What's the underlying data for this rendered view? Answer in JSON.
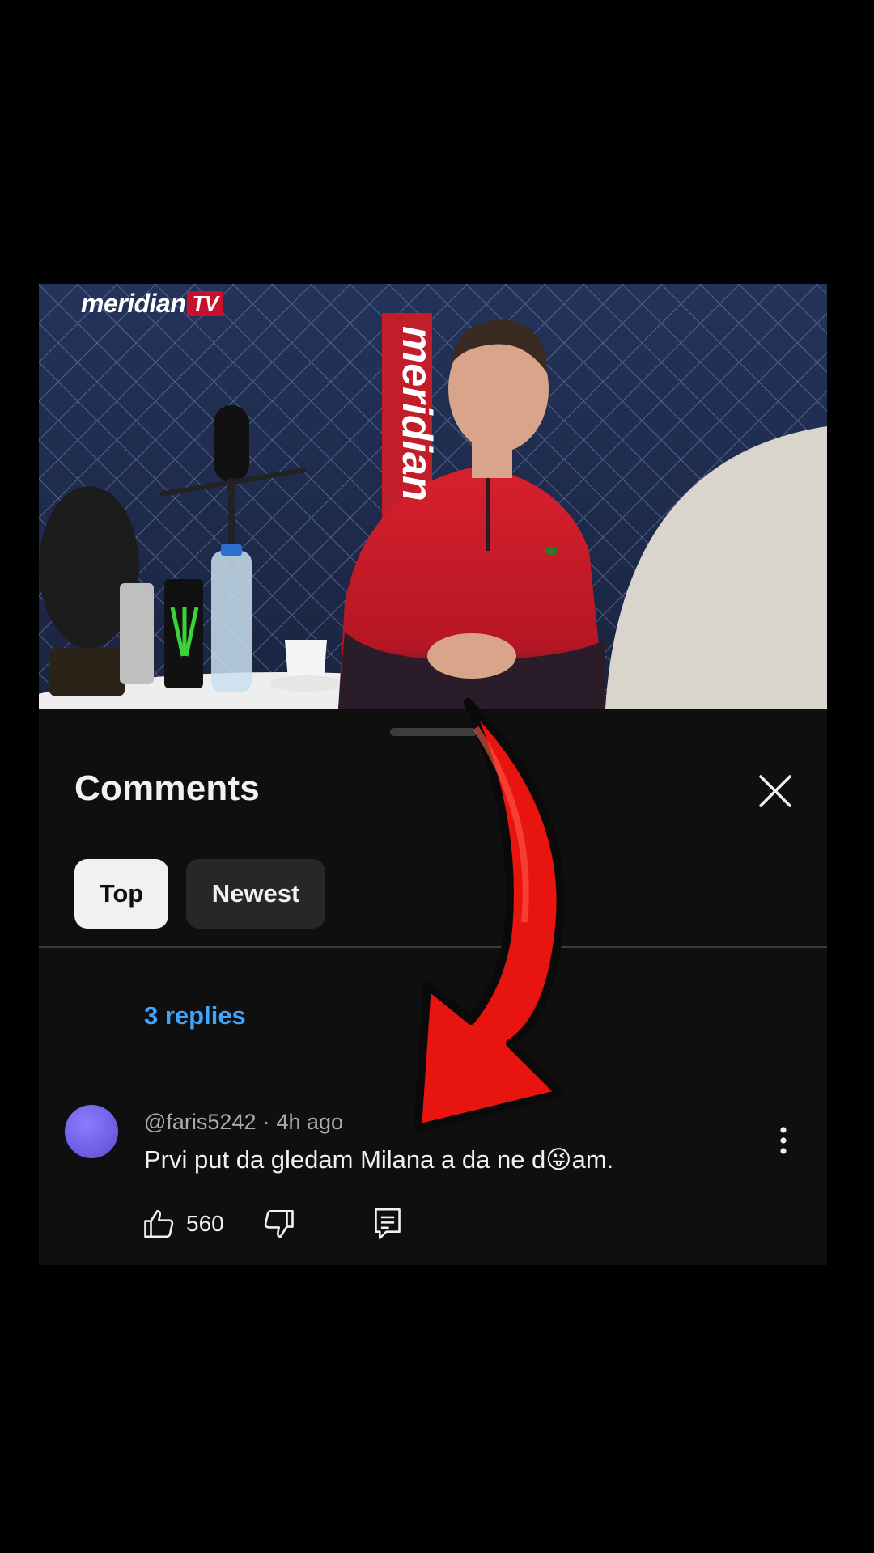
{
  "video": {
    "logo_text": "meridian",
    "logo_badge": "TV",
    "banner_text": "meridian"
  },
  "comments_sheet": {
    "title": "Comments",
    "close_icon": "close-icon",
    "filters": [
      {
        "label": "Top",
        "selected": true
      },
      {
        "label": "Newest",
        "selected": false
      }
    ],
    "replies_link": "3 replies",
    "comment": {
      "author": "@faris5242",
      "separator": "·",
      "time": "4h ago",
      "text": "Prvi put da gledam Milana a da ne d😜am.",
      "like_count": "560",
      "icons": [
        "thumbs-up-icon",
        "thumbs-down-icon",
        "reply-icon",
        "more-vert-icon"
      ]
    }
  },
  "colors": {
    "background": "#000000",
    "sheet": "#0f0f0f",
    "link": "#3ea6ff",
    "arrow": "#e8140f"
  }
}
